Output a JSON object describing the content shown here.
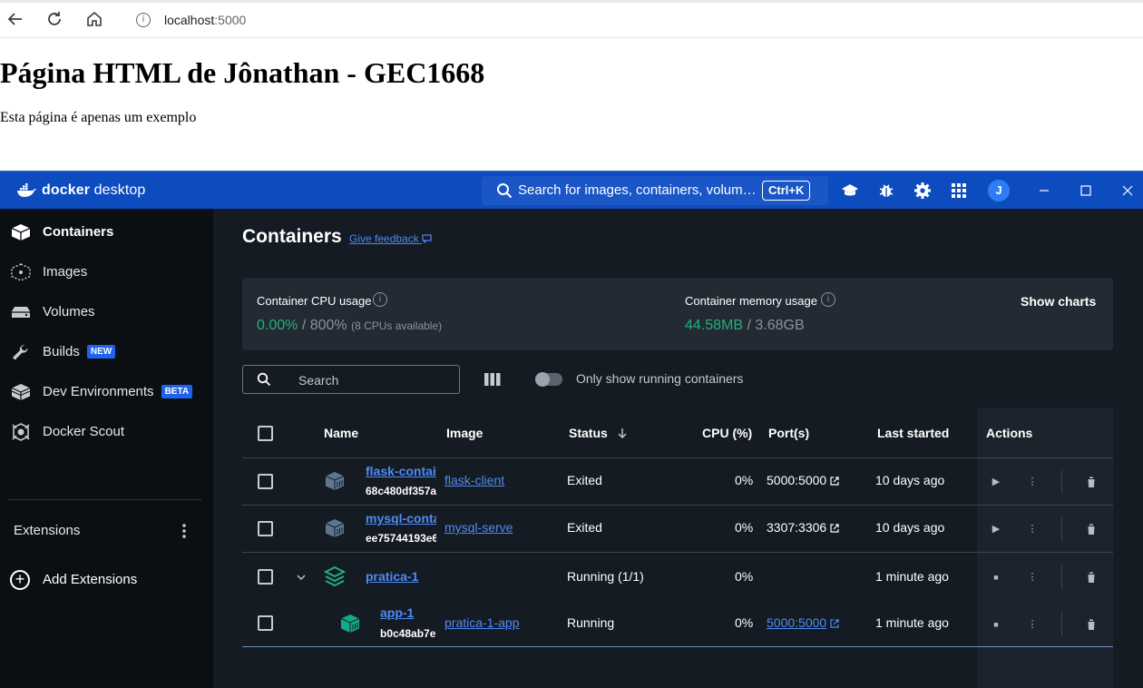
{
  "browser": {
    "url_host": "localhost",
    "url_port": ":5000"
  },
  "webpage": {
    "heading": "Página HTML de Jônathan - GEC1668",
    "paragraph": "Esta página é apenas um exemplo"
  },
  "docker": {
    "app_name_bold": "docker",
    "app_name_rest": " desktop",
    "search_placeholder": "Search for images, containers, volumes...",
    "search_shortcut": "Ctrl+K",
    "avatar_initial": "J",
    "colors": {
      "titlebar": "#0d4cbf",
      "accent": "#1d63ed",
      "green": "#21b17c",
      "link": "#4d8cf7"
    },
    "sidebar": {
      "items": [
        {
          "label": "Containers",
          "icon": "containers-icon",
          "active": true
        },
        {
          "label": "Images",
          "icon": "images-icon"
        },
        {
          "label": "Volumes",
          "icon": "volumes-icon"
        },
        {
          "label": "Builds",
          "icon": "builds-icon",
          "badge": "NEW"
        },
        {
          "label": "Dev Environments",
          "icon": "dev-environments-icon",
          "badge": "BETA"
        },
        {
          "label": "Docker Scout",
          "icon": "docker-scout-icon"
        }
      ],
      "extensions_label": "Extensions",
      "add_extensions_label": "Add Extensions"
    },
    "main": {
      "title": "Containers",
      "feedback_link": "Give feedback",
      "cpu_label": "Container CPU usage",
      "cpu_value": "0.00%",
      "cpu_total": " / 800%",
      "cpu_note": "(8 CPUs available)",
      "mem_label": "Container memory usage",
      "mem_value": "44.58MB",
      "mem_total": " / 3.68GB",
      "show_charts": "Show charts",
      "search_placeholder": "Search",
      "running_toggle_label": "Only show running containers",
      "columns": [
        "Name",
        "Image",
        "Status",
        "CPU (%)",
        "Port(s)",
        "Last started",
        "Actions"
      ],
      "rows": [
        {
          "name": "flask-contai",
          "id": "68c480df357a",
          "image": "flask-client",
          "status": "Exited",
          "cpu": "0%",
          "port": "5000:5000",
          "last_started": "10 days ago"
        },
        {
          "name": "mysql-conta",
          "id": "ee75744193e6",
          "image": "mysql-serve",
          "status": "Exited",
          "cpu": "0%",
          "port": "3307:3306",
          "last_started": "10 days ago"
        },
        {
          "name": "pratica-1",
          "status": "Running (1/1)",
          "cpu": "0%",
          "last_started": "1 minute ago"
        },
        {
          "name": "app-1",
          "id": "b0c48ab7e",
          "image": "pratica-1-app",
          "status": "Running",
          "cpu": "0%",
          "port": "5000:5000",
          "last_started": "1 minute ago"
        }
      ]
    }
  }
}
